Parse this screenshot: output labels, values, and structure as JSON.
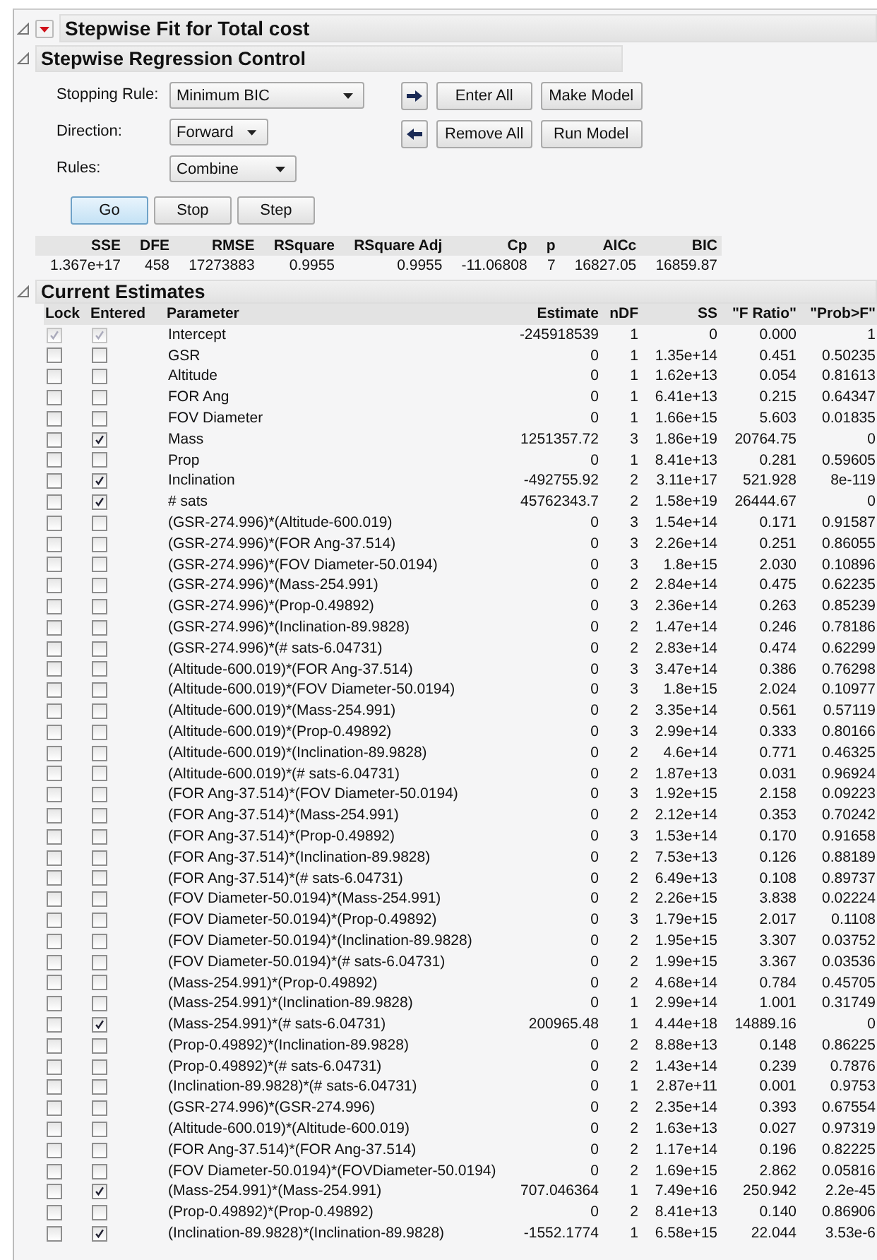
{
  "report": {
    "title": "Stepwise Fit for Total cost"
  },
  "control": {
    "title": "Stepwise Regression Control",
    "fields": [
      {
        "label": "Stopping Rule:",
        "value": "Minimum BIC"
      },
      {
        "label": "Direction:",
        "value": "Forward"
      },
      {
        "label": "Rules:",
        "value": "Combine"
      }
    ],
    "side_buttons": [
      {
        "label": "Enter All",
        "kind": "right"
      },
      {
        "label": "Make Model",
        "kind": "none"
      },
      {
        "label": "Remove All",
        "kind": "left"
      },
      {
        "label": "Run Model",
        "kind": "none"
      }
    ],
    "run_buttons": [
      {
        "label": "Go",
        "selected": true
      },
      {
        "label": "Stop",
        "selected": false
      },
      {
        "label": "Step",
        "selected": false
      }
    ],
    "summary": {
      "columns": [
        "SSE",
        "DFE",
        "RMSE",
        "RSquare",
        "RSquare Adj",
        "Cp",
        "p",
        "AICc",
        "BIC"
      ],
      "values": [
        "1.367e+17",
        "458",
        "17273883",
        "0.9955",
        "0.9955",
        "-11.06808",
        "7",
        "16827.05",
        "16859.87"
      ]
    }
  },
  "estimates": {
    "title": "Current Estimates",
    "columns": [
      "Lock",
      "Entered",
      "Parameter",
      "Estimate",
      "nDF",
      "SS",
      "\"F Ratio\"",
      "\"Prob>F\""
    ],
    "rows": [
      {
        "lock": true,
        "entered": true,
        "disabled": true,
        "parameter": "Intercept",
        "estimate": "-245918539",
        "ndf": "1",
        "ss": "0",
        "f_ratio": "0.000",
        "prob": "1"
      },
      {
        "lock": false,
        "entered": false,
        "disabled": false,
        "parameter": "GSR",
        "estimate": "0",
        "ndf": "1",
        "ss": "1.35e+14",
        "f_ratio": "0.451",
        "prob": "0.50235"
      },
      {
        "lock": false,
        "entered": false,
        "disabled": false,
        "parameter": "Altitude",
        "estimate": "0",
        "ndf": "1",
        "ss": "1.62e+13",
        "f_ratio": "0.054",
        "prob": "0.81613"
      },
      {
        "lock": false,
        "entered": false,
        "disabled": false,
        "parameter": "FOR Ang",
        "estimate": "0",
        "ndf": "1",
        "ss": "6.41e+13",
        "f_ratio": "0.215",
        "prob": "0.64347"
      },
      {
        "lock": false,
        "entered": false,
        "disabled": false,
        "parameter": "FOV Diameter",
        "estimate": "0",
        "ndf": "1",
        "ss": "1.66e+15",
        "f_ratio": "5.603",
        "prob": "0.01835"
      },
      {
        "lock": false,
        "entered": true,
        "disabled": false,
        "parameter": "Mass",
        "estimate": "1251357.72",
        "ndf": "3",
        "ss": "1.86e+19",
        "f_ratio": "20764.75",
        "prob": "0"
      },
      {
        "lock": false,
        "entered": false,
        "disabled": false,
        "parameter": "Prop",
        "estimate": "0",
        "ndf": "1",
        "ss": "8.41e+13",
        "f_ratio": "0.281",
        "prob": "0.59605"
      },
      {
        "lock": false,
        "entered": true,
        "disabled": false,
        "parameter": "Inclination",
        "estimate": "-492755.92",
        "ndf": "2",
        "ss": "3.11e+17",
        "f_ratio": "521.928",
        "prob": "8e-119"
      },
      {
        "lock": false,
        "entered": true,
        "disabled": false,
        "parameter": "# sats",
        "estimate": "45762343.7",
        "ndf": "2",
        "ss": "1.58e+19",
        "f_ratio": "26444.67",
        "prob": "0"
      },
      {
        "lock": false,
        "entered": false,
        "disabled": false,
        "parameter": "(GSR-274.996)*(Altitude-600.019)",
        "estimate": "0",
        "ndf": "3",
        "ss": "1.54e+14",
        "f_ratio": "0.171",
        "prob": "0.91587"
      },
      {
        "lock": false,
        "entered": false,
        "disabled": false,
        "parameter": "(GSR-274.996)*(FOR Ang-37.514)",
        "estimate": "0",
        "ndf": "3",
        "ss": "2.26e+14",
        "f_ratio": "0.251",
        "prob": "0.86055"
      },
      {
        "lock": false,
        "entered": false,
        "disabled": false,
        "parameter": "(GSR-274.996)*(FOV Diameter-50.0194)",
        "estimate": "0",
        "ndf": "3",
        "ss": "1.8e+15",
        "f_ratio": "2.030",
        "prob": "0.10896"
      },
      {
        "lock": false,
        "entered": false,
        "disabled": false,
        "parameter": "(GSR-274.996)*(Mass-254.991)",
        "estimate": "0",
        "ndf": "2",
        "ss": "2.84e+14",
        "f_ratio": "0.475",
        "prob": "0.62235"
      },
      {
        "lock": false,
        "entered": false,
        "disabled": false,
        "parameter": "(GSR-274.996)*(Prop-0.49892)",
        "estimate": "0",
        "ndf": "3",
        "ss": "2.36e+14",
        "f_ratio": "0.263",
        "prob": "0.85239"
      },
      {
        "lock": false,
        "entered": false,
        "disabled": false,
        "parameter": "(GSR-274.996)*(Inclination-89.9828)",
        "estimate": "0",
        "ndf": "2",
        "ss": "1.47e+14",
        "f_ratio": "0.246",
        "prob": "0.78186"
      },
      {
        "lock": false,
        "entered": false,
        "disabled": false,
        "parameter": "(GSR-274.996)*(# sats-6.04731)",
        "estimate": "0",
        "ndf": "2",
        "ss": "2.83e+14",
        "f_ratio": "0.474",
        "prob": "0.62299"
      },
      {
        "lock": false,
        "entered": false,
        "disabled": false,
        "parameter": "(Altitude-600.019)*(FOR Ang-37.514)",
        "estimate": "0",
        "ndf": "3",
        "ss": "3.47e+14",
        "f_ratio": "0.386",
        "prob": "0.76298"
      },
      {
        "lock": false,
        "entered": false,
        "disabled": false,
        "parameter": "(Altitude-600.019)*(FOV Diameter-50.0194)",
        "estimate": "0",
        "ndf": "3",
        "ss": "1.8e+15",
        "f_ratio": "2.024",
        "prob": "0.10977"
      },
      {
        "lock": false,
        "entered": false,
        "disabled": false,
        "parameter": "(Altitude-600.019)*(Mass-254.991)",
        "estimate": "0",
        "ndf": "2",
        "ss": "3.35e+14",
        "f_ratio": "0.561",
        "prob": "0.57119"
      },
      {
        "lock": false,
        "entered": false,
        "disabled": false,
        "parameter": "(Altitude-600.019)*(Prop-0.49892)",
        "estimate": "0",
        "ndf": "3",
        "ss": "2.99e+14",
        "f_ratio": "0.333",
        "prob": "0.80166"
      },
      {
        "lock": false,
        "entered": false,
        "disabled": false,
        "parameter": "(Altitude-600.019)*(Inclination-89.9828)",
        "estimate": "0",
        "ndf": "2",
        "ss": "4.6e+14",
        "f_ratio": "0.771",
        "prob": "0.46325"
      },
      {
        "lock": false,
        "entered": false,
        "disabled": false,
        "parameter": "(Altitude-600.019)*(# sats-6.04731)",
        "estimate": "0",
        "ndf": "2",
        "ss": "1.87e+13",
        "f_ratio": "0.031",
        "prob": "0.96924"
      },
      {
        "lock": false,
        "entered": false,
        "disabled": false,
        "parameter": "(FOR Ang-37.514)*(FOV Diameter-50.0194)",
        "estimate": "0",
        "ndf": "3",
        "ss": "1.92e+15",
        "f_ratio": "2.158",
        "prob": "0.09223"
      },
      {
        "lock": false,
        "entered": false,
        "disabled": false,
        "parameter": "(FOR Ang-37.514)*(Mass-254.991)",
        "estimate": "0",
        "ndf": "2",
        "ss": "2.12e+14",
        "f_ratio": "0.353",
        "prob": "0.70242"
      },
      {
        "lock": false,
        "entered": false,
        "disabled": false,
        "parameter": "(FOR Ang-37.514)*(Prop-0.49892)",
        "estimate": "0",
        "ndf": "3",
        "ss": "1.53e+14",
        "f_ratio": "0.170",
        "prob": "0.91658"
      },
      {
        "lock": false,
        "entered": false,
        "disabled": false,
        "parameter": "(FOR Ang-37.514)*(Inclination-89.9828)",
        "estimate": "0",
        "ndf": "2",
        "ss": "7.53e+13",
        "f_ratio": "0.126",
        "prob": "0.88189"
      },
      {
        "lock": false,
        "entered": false,
        "disabled": false,
        "parameter": "(FOR Ang-37.514)*(# sats-6.04731)",
        "estimate": "0",
        "ndf": "2",
        "ss": "6.49e+13",
        "f_ratio": "0.108",
        "prob": "0.89737"
      },
      {
        "lock": false,
        "entered": false,
        "disabled": false,
        "parameter": "(FOV Diameter-50.0194)*(Mass-254.991)",
        "estimate": "0",
        "ndf": "2",
        "ss": "2.26e+15",
        "f_ratio": "3.838",
        "prob": "0.02224"
      },
      {
        "lock": false,
        "entered": false,
        "disabled": false,
        "parameter": "(FOV Diameter-50.0194)*(Prop-0.49892)",
        "estimate": "0",
        "ndf": "3",
        "ss": "1.79e+15",
        "f_ratio": "2.017",
        "prob": "0.1108"
      },
      {
        "lock": false,
        "entered": false,
        "disabled": false,
        "parameter": "(FOV Diameter-50.0194)*(Inclination-89.9828)",
        "estimate": "0",
        "ndf": "2",
        "ss": "1.95e+15",
        "f_ratio": "3.307",
        "prob": "0.03752"
      },
      {
        "lock": false,
        "entered": false,
        "disabled": false,
        "parameter": "(FOV Diameter-50.0194)*(# sats-6.04731)",
        "estimate": "0",
        "ndf": "2",
        "ss": "1.99e+15",
        "f_ratio": "3.367",
        "prob": "0.03536"
      },
      {
        "lock": false,
        "entered": false,
        "disabled": false,
        "parameter": "(Mass-254.991)*(Prop-0.49892)",
        "estimate": "0",
        "ndf": "2",
        "ss": "4.68e+14",
        "f_ratio": "0.784",
        "prob": "0.45705"
      },
      {
        "lock": false,
        "entered": false,
        "disabled": false,
        "parameter": "(Mass-254.991)*(Inclination-89.9828)",
        "estimate": "0",
        "ndf": "1",
        "ss": "2.99e+14",
        "f_ratio": "1.001",
        "prob": "0.31749"
      },
      {
        "lock": false,
        "entered": true,
        "disabled": false,
        "parameter": "(Mass-254.991)*(# sats-6.04731)",
        "estimate": "200965.48",
        "ndf": "1",
        "ss": "4.44e+18",
        "f_ratio": "14889.16",
        "prob": "0"
      },
      {
        "lock": false,
        "entered": false,
        "disabled": false,
        "parameter": "(Prop-0.49892)*(Inclination-89.9828)",
        "estimate": "0",
        "ndf": "2",
        "ss": "8.88e+13",
        "f_ratio": "0.148",
        "prob": "0.86225"
      },
      {
        "lock": false,
        "entered": false,
        "disabled": false,
        "parameter": "(Prop-0.49892)*(# sats-6.04731)",
        "estimate": "0",
        "ndf": "2",
        "ss": "1.43e+14",
        "f_ratio": "0.239",
        "prob": "0.7876"
      },
      {
        "lock": false,
        "entered": false,
        "disabled": false,
        "parameter": "(Inclination-89.9828)*(# sats-6.04731)",
        "estimate": "0",
        "ndf": "1",
        "ss": "2.87e+11",
        "f_ratio": "0.001",
        "prob": "0.9753"
      },
      {
        "lock": false,
        "entered": false,
        "disabled": false,
        "parameter": "(GSR-274.996)*(GSR-274.996)",
        "estimate": "0",
        "ndf": "2",
        "ss": "2.35e+14",
        "f_ratio": "0.393",
        "prob": "0.67554"
      },
      {
        "lock": false,
        "entered": false,
        "disabled": false,
        "parameter": "(Altitude-600.019)*(Altitude-600.019)",
        "estimate": "0",
        "ndf": "2",
        "ss": "1.63e+13",
        "f_ratio": "0.027",
        "prob": "0.97319"
      },
      {
        "lock": false,
        "entered": false,
        "disabled": false,
        "parameter": "(FOR Ang-37.514)*(FOR Ang-37.514)",
        "estimate": "0",
        "ndf": "2",
        "ss": "1.17e+14",
        "f_ratio": "0.196",
        "prob": "0.82225"
      },
      {
        "lock": false,
        "entered": false,
        "disabled": false,
        "parameter": "(FOV Diameter-50.0194)*(FOVDiameter-50.0194)",
        "estimate": "0",
        "ndf": "2",
        "ss": "1.69e+15",
        "f_ratio": "2.862",
        "prob": "0.05816"
      },
      {
        "lock": false,
        "entered": true,
        "disabled": false,
        "parameter": "(Mass-254.991)*(Mass-254.991)",
        "estimate": "707.046364",
        "ndf": "1",
        "ss": "7.49e+16",
        "f_ratio": "250.942",
        "prob": "2.2e-45"
      },
      {
        "lock": false,
        "entered": false,
        "disabled": false,
        "parameter": "(Prop-0.49892)*(Prop-0.49892)",
        "estimate": "0",
        "ndf": "2",
        "ss": "8.41e+13",
        "f_ratio": "0.140",
        "prob": "0.86906"
      },
      {
        "lock": false,
        "entered": true,
        "disabled": false,
        "parameter": "(Inclination-89.9828)*(Inclination-89.9828)",
        "estimate": "-1552.1774",
        "ndf": "1",
        "ss": "6.58e+15",
        "f_ratio": "22.044",
        "prob": "3.53e-6"
      }
    ]
  }
}
